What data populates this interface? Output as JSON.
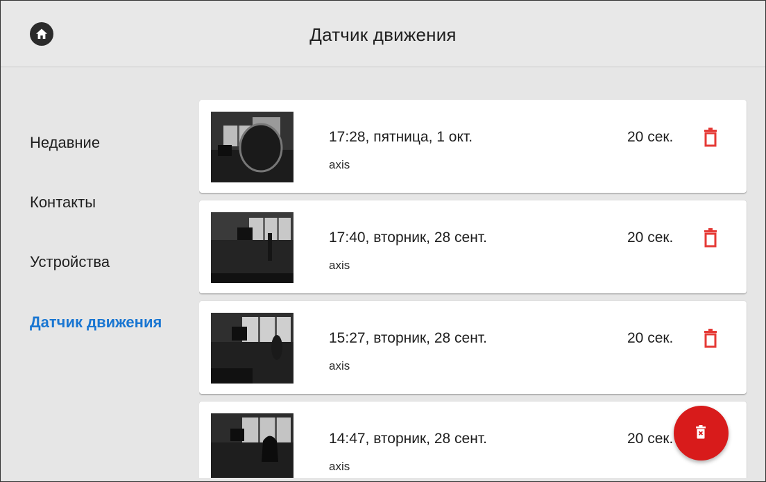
{
  "header": {
    "title": "Датчик движения",
    "home_icon": "home-icon"
  },
  "sidebar": {
    "items": [
      {
        "label": "Недавние",
        "active": false
      },
      {
        "label": "Контакты",
        "active": false
      },
      {
        "label": "Устройства",
        "active": false
      },
      {
        "label": "Датчик движения",
        "active": true
      }
    ]
  },
  "events": [
    {
      "time": "17:28, пятница, 1 окт.",
      "source": "axis",
      "duration": "20 сек."
    },
    {
      "time": "17:40, вторник, 28 сент.",
      "source": "axis",
      "duration": "20 сек."
    },
    {
      "time": "15:27, вторник, 28 сент.",
      "source": "axis",
      "duration": "20 сек."
    },
    {
      "time": "14:47, вторник, 28 сент.",
      "source": "axis",
      "duration": "20 сек."
    }
  ],
  "fab": {
    "icon": "delete-all-icon"
  },
  "colors": {
    "accent": "#1976d2",
    "danger": "#e53935",
    "fab": "#d81b1b",
    "background": "#e6e6e6"
  }
}
